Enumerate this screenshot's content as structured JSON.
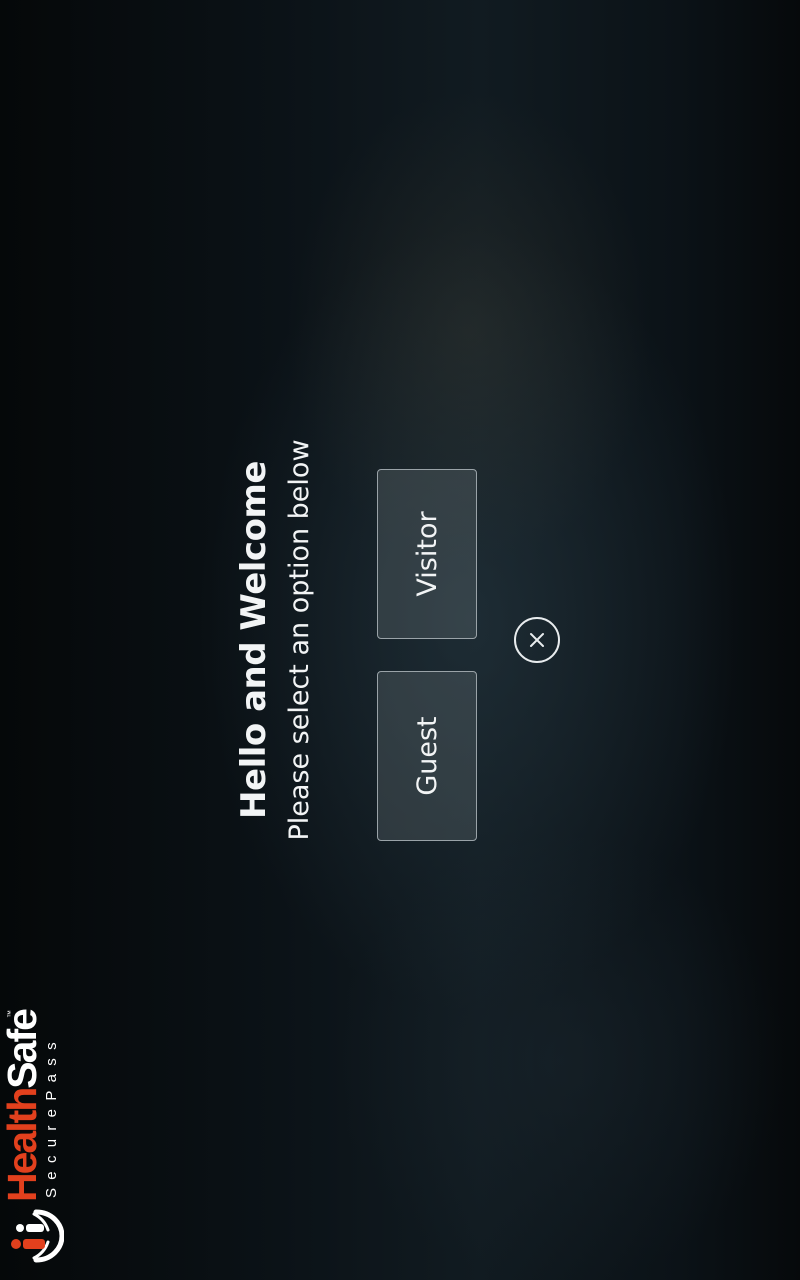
{
  "brand": {
    "name_part1": "Health",
    "name_part2": "Safe",
    "trademark": "™",
    "tagline": "SecurePass",
    "colors": {
      "accent": "#e2401d",
      "text": "#ffffff"
    }
  },
  "welcome": {
    "title": "Hello and Welcome",
    "subtitle": "Please select an option below"
  },
  "options": {
    "guest_label": "Guest",
    "visitor_label": "Visitor"
  },
  "close_icon": "close-x-icon",
  "theme": {
    "background": "#0a1014",
    "button_border": "#9aa3a8",
    "text": "#f2f4f5"
  }
}
